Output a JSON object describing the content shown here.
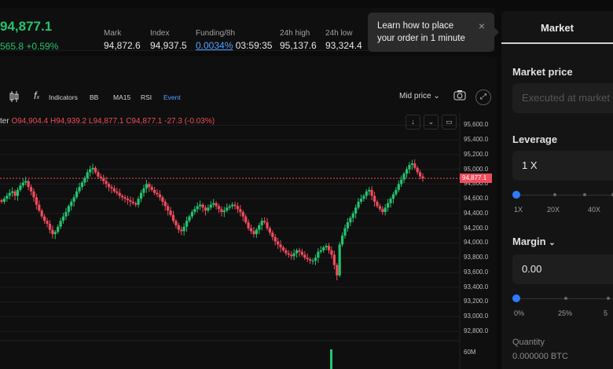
{
  "ticker": {
    "last_price": "94,877.1",
    "change": "565.8 +0.59%",
    "stats": [
      {
        "label": "Mark",
        "value": "94,872.6"
      },
      {
        "label": "Index",
        "value": "94,937.5"
      },
      {
        "label": "Funding/8h",
        "rate": "0.0034%",
        "countdown": "03:59:35"
      },
      {
        "label": "24h high",
        "value": "95,137.6"
      },
      {
        "label": "24h low",
        "value": "93,324.4"
      }
    ]
  },
  "tooltip": {
    "text_line1": "Learn how to place",
    "text_line2": "your order in 1 minute",
    "close": "×"
  },
  "chart_toolbar": {
    "indicators": "Indicators",
    "bb": "BB",
    "ma15": "MA15",
    "rsi": "RSI",
    "event": "Event",
    "mid_price": "Mid price"
  },
  "ohlc": {
    "name": "ter",
    "open_label": "O",
    "open": "94,904.4",
    "high_label": "H",
    "high": "94,939.2",
    "low_label": "L",
    "low": "94,877.1",
    "close_label": "C",
    "close": "94,877.1",
    "change": "-27.3 (-0.03%)"
  },
  "colors": {
    "up": "#25c26e",
    "down": "#ef4c5c",
    "accent": "#4ea1ff",
    "slider": "#2b7cff"
  },
  "chart_data": {
    "type": "candlestick",
    "y_ticks": [
      "95,600.0",
      "95,400.0",
      "95,200.0",
      "95,000.0",
      "94,800.0",
      "94,600.0",
      "94,400.0",
      "94,200.0",
      "94,000.0",
      "93,800.0",
      "93,600.0",
      "93,400.0",
      "93,200.0",
      "93,000.0",
      "92,800.0"
    ],
    "ylim": [
      92800,
      95700
    ],
    "last_price_tag": "94,877.1",
    "volume_tick": "60M",
    "close_series": [
      94560,
      94600,
      94640,
      94680,
      94700,
      94640,
      94720,
      94780,
      94820,
      94840,
      94760,
      94700,
      94620,
      94520,
      94440,
      94360,
      94300,
      94260,
      94180,
      94120,
      94150,
      94220,
      94300,
      94360,
      94420,
      94500,
      94560,
      94620,
      94700,
      94760,
      94820,
      94880,
      94960,
      95000,
      95020,
      94960,
      94900,
      94880,
      94840,
      94800,
      94760,
      94740,
      94700,
      94680,
      94640,
      94620,
      94600,
      94580,
      94560,
      94540,
      94520,
      94600,
      94680,
      94740,
      94800,
      94760,
      94720,
      94680,
      94660,
      94620,
      94560,
      94500,
      94440,
      94380,
      94300,
      94240,
      94180,
      94160,
      94220,
      94300,
      94360,
      94420,
      94460,
      94500,
      94520,
      94480,
      94440,
      94480,
      94520,
      94540,
      94500,
      94460,
      94420,
      94440,
      94480,
      94500,
      94520,
      94500,
      94460,
      94420,
      94360,
      94280,
      94200,
      94160,
      94120,
      94180,
      94240,
      94300,
      94280,
      94200,
      94140,
      94080,
      94020,
      93980,
      93940,
      93900,
      93860,
      93840,
      93820,
      93860,
      93900,
      93880,
      93840,
      93800,
      93780,
      93760,
      93760,
      93800,
      93880,
      93900,
      93940,
      93960,
      93900,
      93840,
      93700,
      93560,
      93980,
      94100,
      94200,
      94280,
      94340,
      94400,
      94480,
      94560,
      94600,
      94640,
      94700,
      94720,
      94640,
      94560,
      94500,
      94460,
      94420,
      94480,
      94540,
      94600,
      94660,
      94720,
      94800,
      94860,
      94940,
      95000,
      95060,
      95080,
      95020,
      94960,
      94904,
      94877
    ]
  },
  "order_panel": {
    "tab": "Market",
    "market_price_label": "Market price",
    "market_price_placeholder": "Executed at market price",
    "leverage_label": "Leverage",
    "leverage_value": "1 X",
    "leverage_ticks": [
      "1X",
      "20X",
      "40X"
    ],
    "leverage_level": 0,
    "margin_label": "Margin",
    "margin_value": "0.00",
    "margin_ticks": [
      "0%",
      "25%",
      "5"
    ],
    "margin_level": 0,
    "quantity_label": "Quantity",
    "quantity_value": "0.000000 BTC"
  }
}
